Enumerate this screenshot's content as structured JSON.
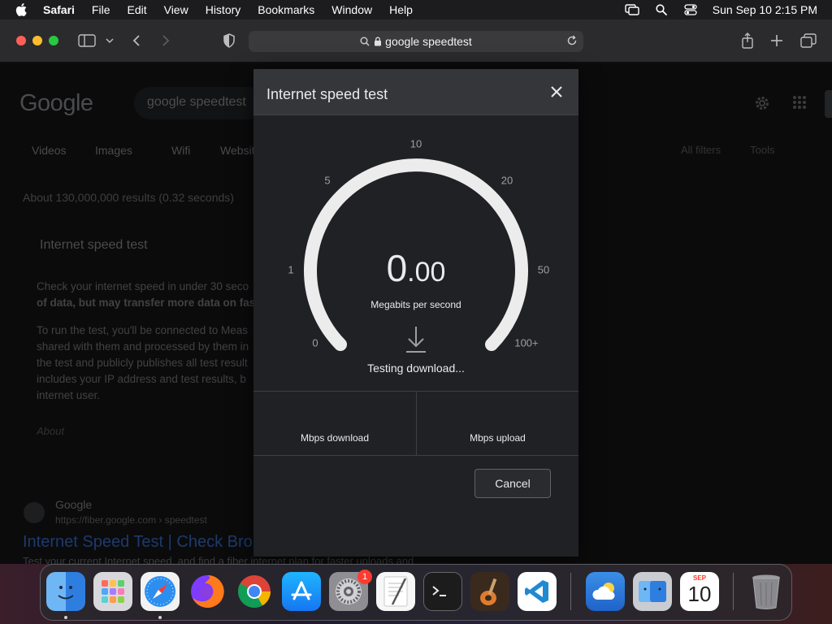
{
  "menubar": {
    "app_name": "Safari",
    "items": [
      "File",
      "Edit",
      "View",
      "History",
      "Bookmarks",
      "Window",
      "Help"
    ],
    "clock": "Sun Sep 10  2:15 PM",
    "icons": [
      "screen-mirroring-icon",
      "search-icon",
      "control-center-icon"
    ]
  },
  "browser": {
    "url": "google speedtest"
  },
  "background_page": {
    "logo": "Google",
    "search_text": "google speedtest",
    "tabs": [
      "Videos",
      "Images",
      "Wifi",
      "Website"
    ],
    "tools": [
      "All filters",
      "Tools"
    ],
    "result_count": "About 130,000,000 results (0.32 seconds)",
    "card_title": "Internet speed test",
    "card_paragraphs": [
      "Check your internet speed in under 30 seco",
      "of data, but may transfer more data on fast",
      "To run the test, you'll be connected to Meas",
      "shared with them and processed by them in",
      "the test and publicly publishes all test result",
      "includes your IP address and test results, b",
      "internet user."
    ],
    "about": "About",
    "result_site": "Google",
    "result_url": "https://fiber.google.com › speedtest",
    "result_title": "Internet Speed Test | Check Bro",
    "result_snippet": "Test your current Internet speed, and find a fiber internet plan for faster uploads and"
  },
  "modal": {
    "title": "Internet speed test",
    "gauge_ticks": [
      "0",
      "1",
      "5",
      "10",
      "20",
      "50",
      "100+"
    ],
    "speed_integer": "0",
    "speed_decimal": ".00",
    "unit": "Megabits per second",
    "status": "Testing download...",
    "download_label": "Mbps download",
    "upload_label": "Mbps upload",
    "cancel_label": "Cancel"
  },
  "dock": {
    "apps": [
      "Finder",
      "Launchpad",
      "Safari",
      "Firefox",
      "Chrome",
      "App Store",
      "System Settings",
      "TextEdit",
      "Terminal",
      "GarageBand",
      "Visual Studio Code",
      "Weather",
      "Migration Assistant",
      "Calendar",
      "Trash"
    ],
    "settings_badge": "1",
    "calendar_month": "SEP",
    "calendar_day": "10"
  }
}
